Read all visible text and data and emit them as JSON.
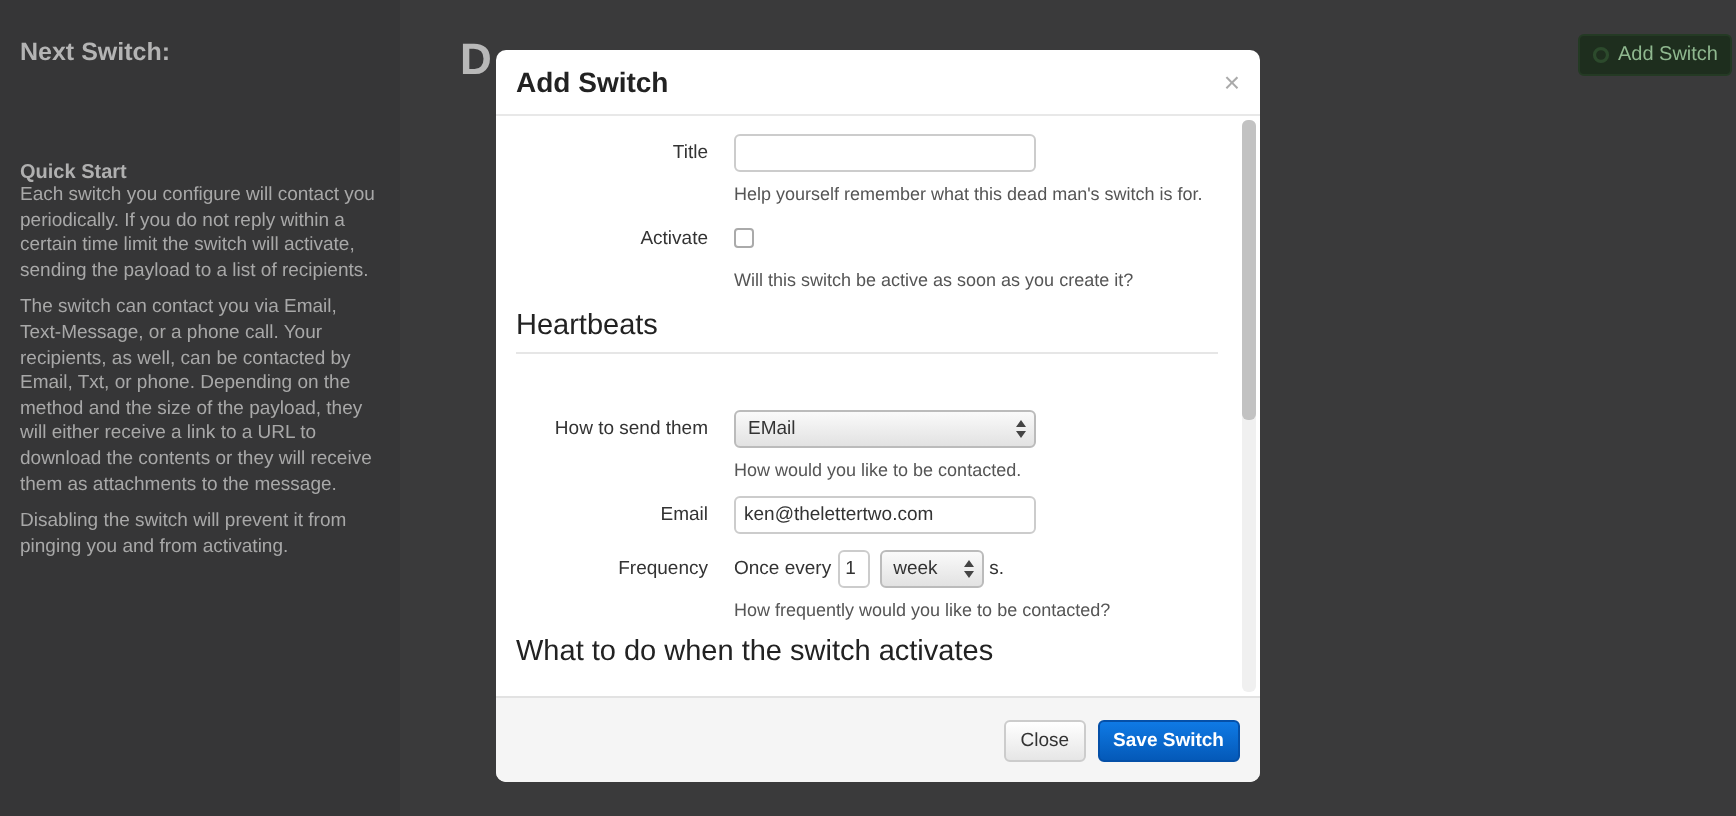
{
  "sidebar": {
    "title": "Next Switch:",
    "quick_start": {
      "heading": "Quick Start",
      "paragraphs": [
        "Each switch you configure will contact you periodically. If you do not reply within a certain time limit the switch will activate, sending the payload to a list of recipients.",
        "The switch can contact you via Email, Text-Message, or a phone call. Your recipients, as well, can be contacted by Email, Txt, or phone. Depending on the method and the size of the payload, they will either receive a link to a URL to download the contents or they will receive them as attachments to the message.",
        "Disabling the switch will prevent it from pinging you and from activating."
      ]
    }
  },
  "page_title": "D",
  "add_button": {
    "label": "Add Switch"
  },
  "modal": {
    "title": "Add Switch",
    "close": "×",
    "title_field": {
      "label": "Title",
      "help": "Help yourself remember what this dead man's switch is for."
    },
    "activate": {
      "label": "Activate",
      "checked": false,
      "help": "Will this switch be active as soon as you create it?"
    },
    "heartbeats_heading": "Heartbeats",
    "method": {
      "label": "How to send them",
      "value": "EMail",
      "help": "How would you like to be contacted."
    },
    "email": {
      "label": "Email",
      "value": "ken@thelettertwo.com"
    },
    "frequency": {
      "label": "Frequency",
      "prefix": "Once every",
      "count": "1",
      "unit": "week",
      "suffix": "s.",
      "help": "How frequently would you like to be contacted?"
    },
    "next_heading": "What to do when the switch activates",
    "buttons": [
      {
        "label": "Close",
        "kind": "default"
      },
      {
        "label": "Save Switch",
        "kind": "primary"
      }
    ]
  }
}
